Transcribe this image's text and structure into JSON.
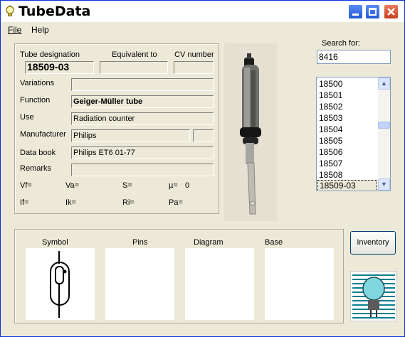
{
  "window": {
    "title": "TubeData"
  },
  "menu": {
    "items": [
      "File",
      "Help"
    ]
  },
  "details": {
    "designation_label": "Tube designation",
    "designation_value": "18509-03",
    "equivalent_label": "Equivalent to",
    "equivalent_value": "",
    "cv_label": "CV number",
    "cv_value": "",
    "variations_label": "Variations",
    "variations_value": "",
    "function_label": "Function",
    "function_value": "Geiger-Müller tube",
    "use_label": "Use",
    "use_value": "Radiation counter",
    "manufacturer_label": "Manufacturer",
    "manufacturer_value": "Philips",
    "manufacturer_code": "",
    "databook_label": "Data book",
    "databook_value": "Philips ET6  01-77",
    "remarks_label": "Remarks",
    "remarks_value": ""
  },
  "params": {
    "vf": "Vf=",
    "va": "Va=",
    "s": "S=",
    "mu": "µ=",
    "mu_value": "0",
    "if": "If=",
    "ik": "Ik=",
    "ri": "Ri=",
    "pa": "Pa="
  },
  "search": {
    "label": "Search for:",
    "value": "8416"
  },
  "list": {
    "items": [
      "18500",
      "18501",
      "18502",
      "18503",
      "18504",
      "18505",
      "18506",
      "18507",
      "18508",
      "18509-03"
    ],
    "selected": "18509-03"
  },
  "panels": {
    "symbol": "Symbol",
    "pins": "Pins",
    "diagram": "Diagram",
    "base": "Base"
  },
  "buttons": {
    "inventory": "Inventory"
  },
  "icons": {
    "app": "lightbulb-icon",
    "minimize": "minimize-icon",
    "maximize": "maximize-icon",
    "close": "close-icon",
    "scroll_up": "arrow-up-icon",
    "scroll_down": "arrow-down-icon"
  }
}
